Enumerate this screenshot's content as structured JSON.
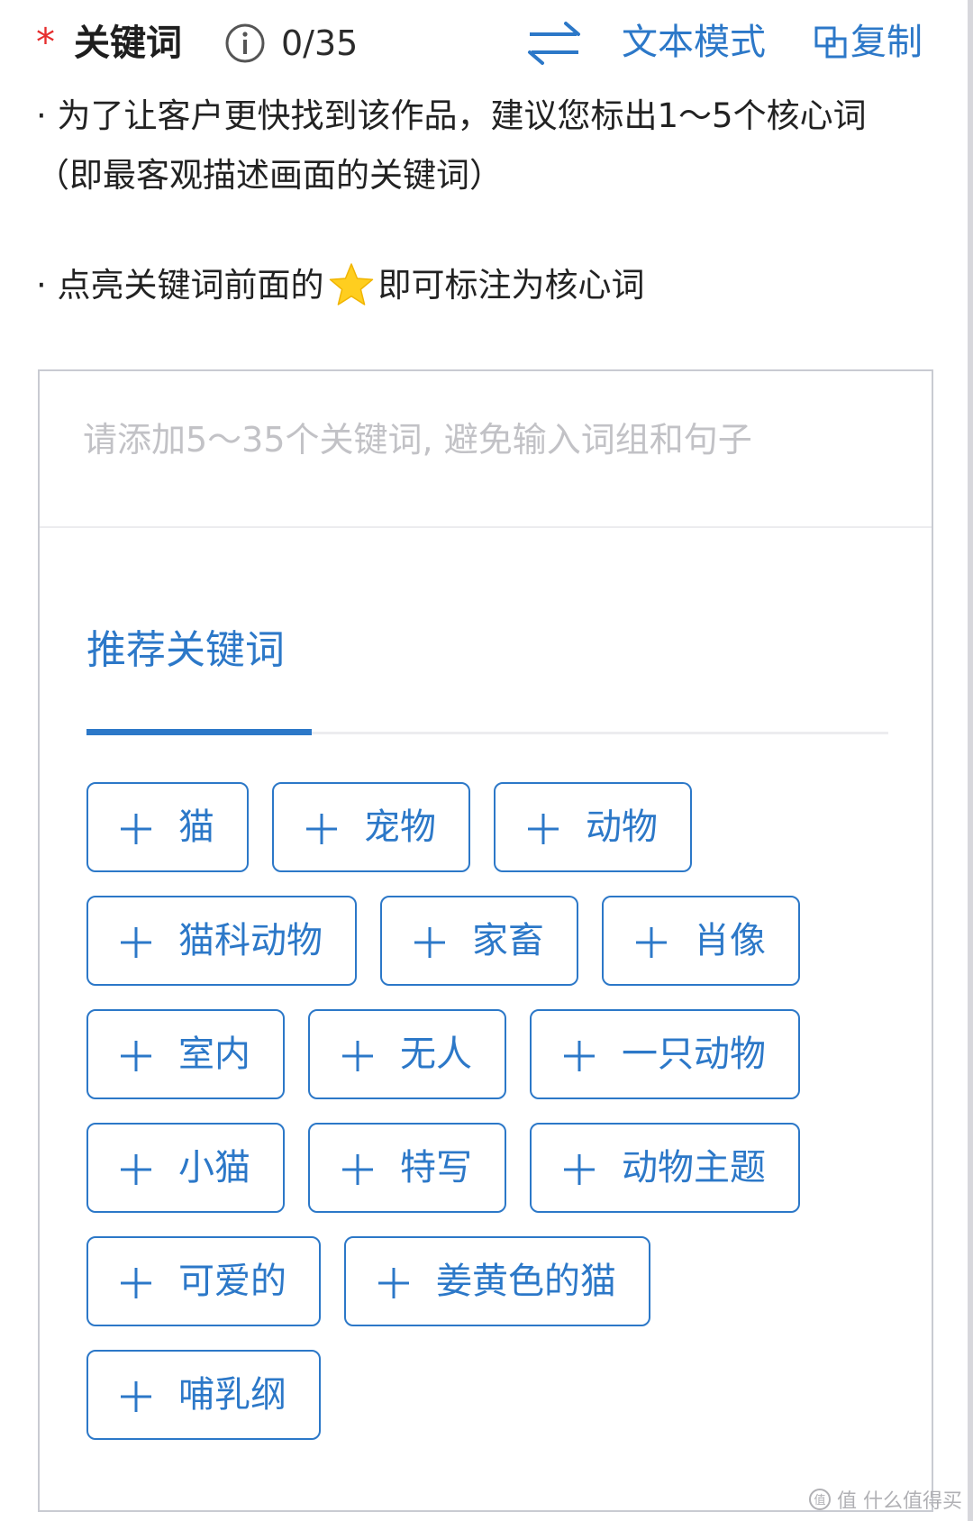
{
  "header": {
    "required_mark": "*",
    "title": "关键词",
    "count": "0/35",
    "text_mode_label": "文本模式",
    "copy_label": "复制"
  },
  "tips": {
    "line1": "· 为了让客户更快找到该作品，建议您标出1～5个核心词（即最客观描述画面的关键词）",
    "line2_before": "· 点亮关键词前面的",
    "line2_after": "即可标注为核心词"
  },
  "input": {
    "value": "",
    "placeholder": "请添加5～35个关键词, 避免输入词组和句子"
  },
  "recommend": {
    "tab_label": "推荐关键词",
    "tags": [
      "猫",
      "宠物",
      "动物",
      "猫科动物",
      "家畜",
      "肖像",
      "室内",
      "无人",
      "一只动物",
      "小猫",
      "特写",
      "动物主题",
      "可爱的",
      "姜黄色的猫",
      "哺乳纲"
    ]
  },
  "watermark": {
    "text": "值 什么值得买"
  },
  "icons": {
    "info": "info-circle-icon",
    "swap": "swap-arrows-icon",
    "copy": "copy-icon",
    "star": "star-icon",
    "plus": "plus-icon"
  },
  "colors": {
    "accent": "#2c78c8",
    "required": "#e62e2e",
    "star": "#ffce1f",
    "border": "#c9cbd2",
    "placeholder": "#c2c2c6"
  }
}
